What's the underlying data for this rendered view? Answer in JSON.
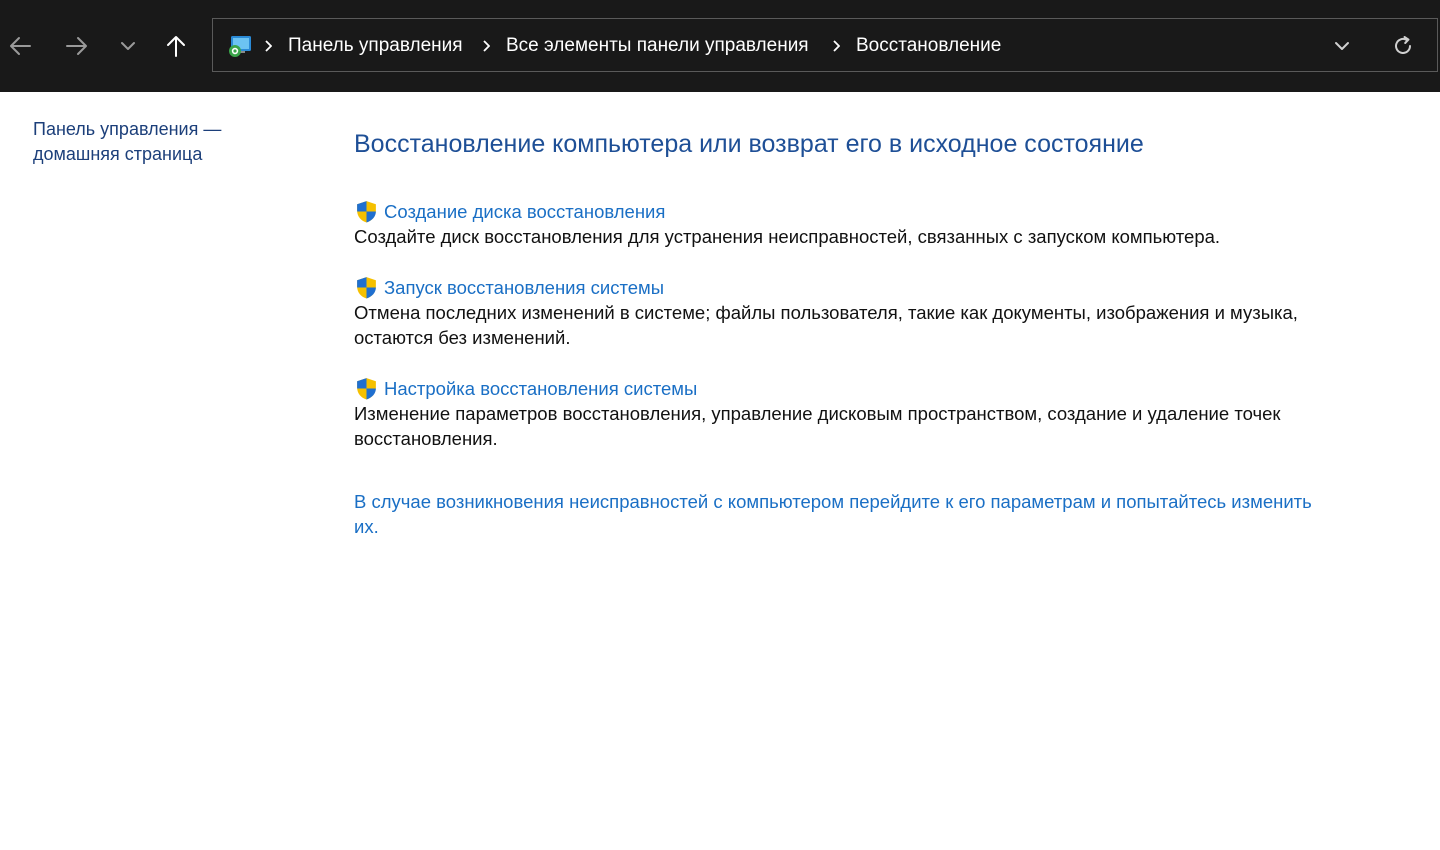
{
  "nav": {
    "back_icon": "arrow-left-icon",
    "forward_icon": "arrow-right-icon",
    "recent_icon": "chevron-down-icon",
    "up_icon": "arrow-up-icon"
  },
  "address_bar": {
    "location_icon": "control-panel-icon",
    "breadcrumbs": [
      {
        "label": "Панель управления"
      },
      {
        "label": "Все элементы панели управления"
      },
      {
        "label": "Восстановление"
      }
    ],
    "dropdown_icon": "chevron-down-icon",
    "refresh_icon": "refresh-icon"
  },
  "sidebar": {
    "home_link": "Панель управления — домашняя страница"
  },
  "main": {
    "title": "Восстановление компьютера или возврат его в исходное состояние",
    "tasks": [
      {
        "icon": "uac-shield-icon",
        "link": "Создание диска восстановления",
        "description": "Создайте диск восстановления для устранения неисправностей, связанных с запуском компьютера."
      },
      {
        "icon": "uac-shield-icon",
        "link": "Запуск восстановления системы",
        "description": "Отмена последних изменений в системе; файлы пользователя, такие как документы, изображения и музыка, остаются без изменений."
      },
      {
        "icon": "uac-shield-icon",
        "link": "Настройка восстановления системы",
        "description": "Изменение параметров восстановления, управление дисковым пространством, создание и удаление точек восстановления."
      }
    ],
    "settings_link": "В случае возникновения неисправностей с компьютером перейдите к его параметрам и попытайтесь изменить их."
  },
  "colors": {
    "titlebar_bg": "#191919",
    "link_blue": "#1a6fc5",
    "title_blue": "#1e4f96",
    "sidebar_link": "#1c3f7a",
    "shield_blue": "#1f6fd0",
    "shield_yellow": "#f5c000"
  }
}
